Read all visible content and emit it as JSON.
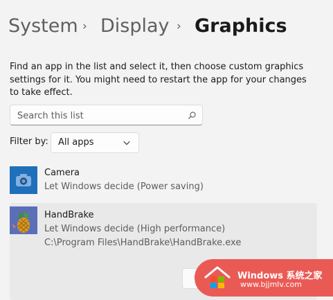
{
  "breadcrumb": {
    "items": [
      "System",
      "Display"
    ],
    "current": "Graphics",
    "separator": "›"
  },
  "description": "Find an app in the list and select it, then choose custom graphics settings for it. You might need to restart the app for your changes to take effect.",
  "search": {
    "placeholder": "Search this list",
    "value": "",
    "icon": "search-icon"
  },
  "filter": {
    "label": "Filter by:",
    "selected": "All apps",
    "icon": "chevron-down-icon"
  },
  "apps": [
    {
      "name": "Camera",
      "status": "Let Windows decide (Power saving)",
      "icon": "camera-icon"
    },
    {
      "name": "HandBrake",
      "status": "Let Windows decide (High performance)",
      "path": "C:\\Program Files\\HandBrake\\HandBrake.exe",
      "icon": "handbrake-pineapple-icon"
    }
  ],
  "watermark": {
    "title": "Windows 系统之家",
    "url": "www.bjjmlv.com"
  },
  "colors": {
    "background": "#f3f3f3",
    "selected_card": "#e9e9e9",
    "camera_tile": "#1f6fba",
    "watermark": "#ea5a55"
  }
}
